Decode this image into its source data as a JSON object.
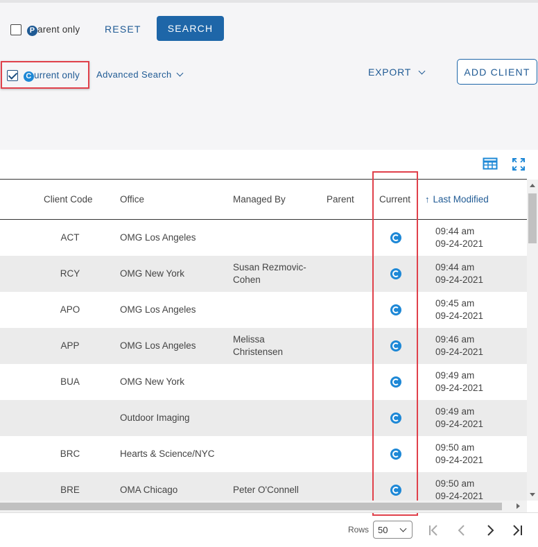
{
  "filters": {
    "parent_only": {
      "badge": "P",
      "label": "arent only",
      "checked": false
    },
    "reset_label": "RESET",
    "search_label": "SEARCH",
    "current_only": {
      "badge": "C",
      "label": "urrent only",
      "checked": true
    },
    "advanced_search_label": "Advanced Search",
    "export_label": "EXPORT",
    "add_client_label": "ADD CLIENT"
  },
  "table": {
    "icons": [
      "columns-icon",
      "fullscreen-icon"
    ],
    "columns": {
      "client_code": "Client Code",
      "office": "Office",
      "managed_by": "Managed By",
      "parent": "Parent",
      "current": "Current",
      "last_modified": "Last Modified"
    },
    "sort": {
      "column": "last_modified",
      "direction": "ascending",
      "arrow": "↑"
    },
    "rows": [
      {
        "code": "ACT",
        "office": "OMG Los Angeles",
        "managed_by": [
          "",
          ""
        ],
        "parent": "",
        "current": true,
        "time": "09:44 am",
        "date": "09-24-2021"
      },
      {
        "code": "RCY",
        "office": "OMG New York",
        "managed_by": [
          "Susan Rezmovic-",
          "Cohen"
        ],
        "parent": "",
        "current": true,
        "time": "09:44 am",
        "date": "09-24-2021"
      },
      {
        "code": "APO",
        "office": "OMG Los Angeles",
        "managed_by": [
          "",
          ""
        ],
        "parent": "",
        "current": true,
        "time": "09:45 am",
        "date": "09-24-2021"
      },
      {
        "code": "APP",
        "office": "OMG Los Angeles",
        "managed_by": [
          "Melissa",
          "Christensen"
        ],
        "parent": "",
        "current": true,
        "time": "09:46 am",
        "date": "09-24-2021"
      },
      {
        "code": "BUA",
        "office": "OMG New York",
        "managed_by": [
          "",
          ""
        ],
        "parent": "",
        "current": true,
        "time": "09:49 am",
        "date": "09-24-2021"
      },
      {
        "code": "",
        "office": "Outdoor Imaging",
        "managed_by": [
          "",
          ""
        ],
        "parent": "",
        "current": true,
        "time": "09:49 am",
        "date": "09-24-2021"
      },
      {
        "code": "BRC",
        "office": "Hearts & Science/NYC",
        "managed_by": [
          "",
          ""
        ],
        "parent": "",
        "current": true,
        "time": "09:50 am",
        "date": "09-24-2021"
      },
      {
        "code": "BRE",
        "office": "OMA Chicago",
        "managed_by": [
          "Peter O'Connell",
          ""
        ],
        "parent": "",
        "current": true,
        "time": "09:50 am",
        "date": "09-24-2021"
      }
    ]
  },
  "footer": {
    "rows_label": "Rows",
    "rows_value": "50",
    "pager_icons": [
      "first-page-icon",
      "previous-page-icon",
      "next-page-icon",
      "last-page-icon"
    ]
  },
  "colors": {
    "accent": "#1e66a8",
    "current_badge": "#1e88d6",
    "highlight_box": "#e0404a"
  }
}
